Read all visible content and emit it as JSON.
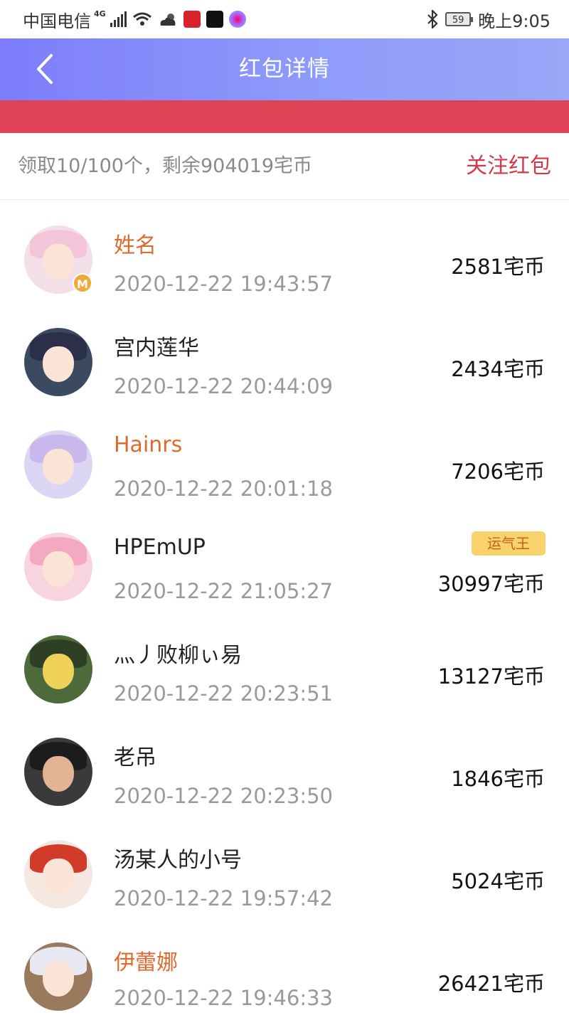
{
  "status_bar": {
    "carrier": "中国电信",
    "network": "4G",
    "battery": "59",
    "time": "晚上9:05"
  },
  "header": {
    "title": "红包详情",
    "back_icon": "chevron-left-icon",
    "background": "#8b96fa"
  },
  "accent_color": "#e04256",
  "summary": {
    "text": "领取10/100个，剩余904019宅币",
    "follow_label": "关注红包"
  },
  "recipients": [
    {
      "name": "姓名",
      "time": "2020-12-22 19:43:57",
      "amount": "2581宅币",
      "vip": true,
      "badge": "M"
    },
    {
      "name": "宫内莲华",
      "time": "2020-12-22 20:44:09",
      "amount": "2434宅币",
      "vip": false
    },
    {
      "name": "Hainrs",
      "time": "2020-12-22 20:01:18",
      "amount": "7206宅币",
      "vip": true
    },
    {
      "name": "HPEmUP",
      "time": "2020-12-22 21:05:27",
      "amount": "30997宅币",
      "vip": false,
      "tag": "运气王"
    },
    {
      "name": "灬丿败柳ぃ易",
      "time": "2020-12-22 20:23:51",
      "amount": "13127宅币",
      "vip": false
    },
    {
      "name": "老吊",
      "time": "2020-12-22 20:23:50",
      "amount": "1846宅币",
      "vip": false
    },
    {
      "name": "汤某人的小号",
      "time": "2020-12-22 19:57:42",
      "amount": "5024宅币",
      "vip": false
    },
    {
      "name": "伊蕾娜",
      "time": "2020-12-22 19:46:33",
      "amount": "26421宅币",
      "vip": true
    }
  ]
}
